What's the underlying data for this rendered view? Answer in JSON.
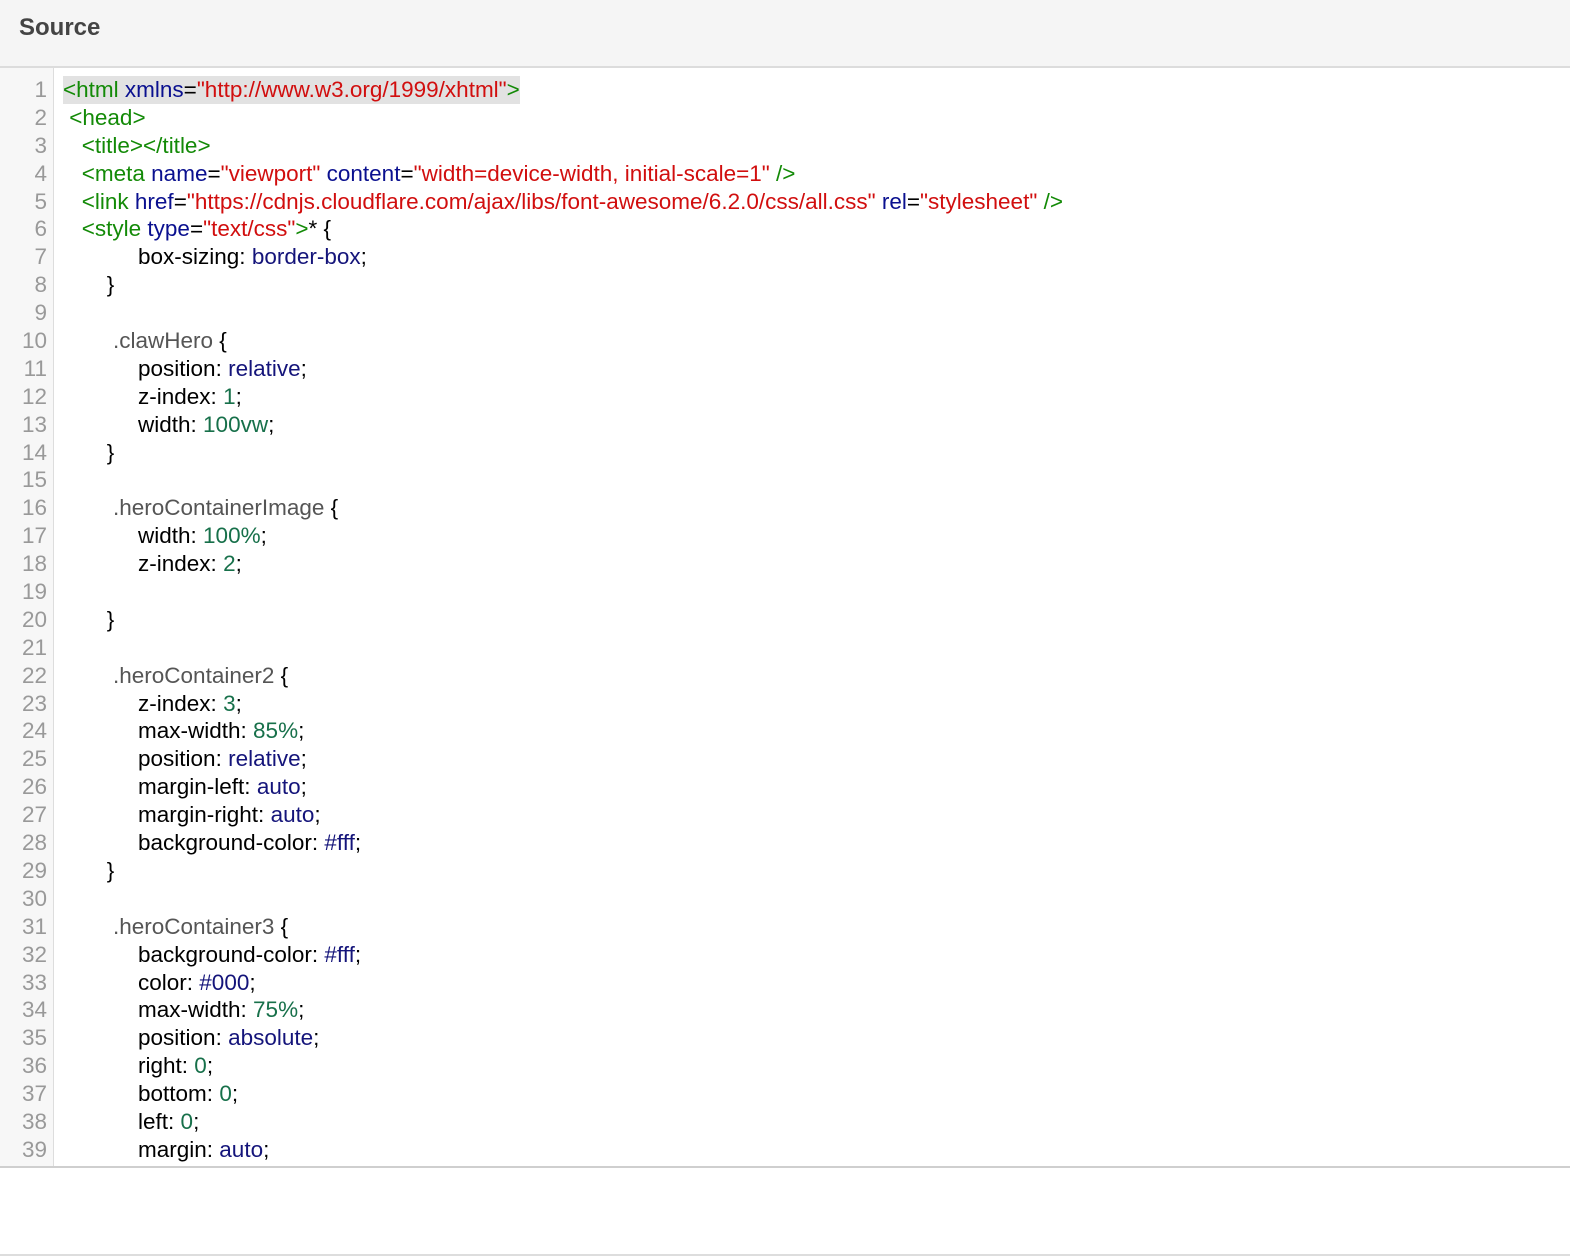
{
  "panel": {
    "title": "Source",
    "highlighted_line": 1
  },
  "colors": {
    "tag": "#138a07",
    "attribute": "#0a108f",
    "string": "#d10e0e",
    "number": "#17704a",
    "keyword": "#14147a",
    "selector": "#555555",
    "plain": "#000000"
  },
  "lines": [
    {
      "n": "1",
      "tokens": [
        [
          "tag",
          "<html "
        ],
        [
          "attr",
          "xmlns"
        ],
        [
          "plain",
          "="
        ],
        [
          "str",
          "\"http://www.w3.org/1999/xhtml\""
        ],
        [
          "tag",
          ">"
        ]
      ]
    },
    {
      "n": "2",
      "tokens": [
        [
          "tag",
          " <head>"
        ]
      ]
    },
    {
      "n": "3",
      "tokens": [
        [
          "tag",
          "   <title></title>"
        ]
      ]
    },
    {
      "n": "4",
      "tokens": [
        [
          "tag",
          "   <meta "
        ],
        [
          "attr",
          "name"
        ],
        [
          "plain",
          "="
        ],
        [
          "str",
          "\"viewport\""
        ],
        [
          "plain",
          " "
        ],
        [
          "attr",
          "content"
        ],
        [
          "plain",
          "="
        ],
        [
          "str",
          "\"width=device-width, initial-scale=1\""
        ],
        [
          "tag",
          " />"
        ]
      ]
    },
    {
      "n": "5",
      "tokens": [
        [
          "tag",
          "   <link "
        ],
        [
          "attr",
          "href"
        ],
        [
          "plain",
          "="
        ],
        [
          "str",
          "\"https://cdnjs.cloudflare.com/ajax/libs/font-awesome/6.2.0/css/all.css\""
        ],
        [
          "plain",
          " "
        ],
        [
          "attr",
          "rel"
        ],
        [
          "plain",
          "="
        ],
        [
          "str",
          "\"stylesheet\""
        ],
        [
          "tag",
          " />"
        ]
      ]
    },
    {
      "n": "6",
      "tokens": [
        [
          "tag",
          "   <style "
        ],
        [
          "attr",
          "type"
        ],
        [
          "plain",
          "="
        ],
        [
          "str",
          "\"text/css\""
        ],
        [
          "tag",
          ">"
        ],
        [
          "plain",
          "* {"
        ]
      ]
    },
    {
      "n": "7",
      "tokens": [
        [
          "plain",
          "            box-sizing: "
        ],
        [
          "kw",
          "border-box"
        ],
        [
          "plain",
          ";"
        ]
      ]
    },
    {
      "n": "8",
      "tokens": [
        [
          "plain",
          "       }"
        ]
      ]
    },
    {
      "n": "9",
      "tokens": [
        [
          "plain",
          ""
        ]
      ]
    },
    {
      "n": "10",
      "tokens": [
        [
          "sel",
          "        .clawHero"
        ],
        [
          "plain",
          " {"
        ]
      ]
    },
    {
      "n": "11",
      "tokens": [
        [
          "plain",
          "            position: "
        ],
        [
          "kw",
          "relative"
        ],
        [
          "plain",
          ";"
        ]
      ]
    },
    {
      "n": "12",
      "tokens": [
        [
          "plain",
          "            z-index: "
        ],
        [
          "num",
          "1"
        ],
        [
          "plain",
          ";"
        ]
      ]
    },
    {
      "n": "13",
      "tokens": [
        [
          "plain",
          "            width: "
        ],
        [
          "num",
          "100vw"
        ],
        [
          "plain",
          ";"
        ]
      ]
    },
    {
      "n": "14",
      "tokens": [
        [
          "plain",
          "       }"
        ]
      ]
    },
    {
      "n": "15",
      "tokens": [
        [
          "plain",
          ""
        ]
      ]
    },
    {
      "n": "16",
      "tokens": [
        [
          "sel",
          "        .heroContainerImage"
        ],
        [
          "plain",
          " {"
        ]
      ]
    },
    {
      "n": "17",
      "tokens": [
        [
          "plain",
          "            width: "
        ],
        [
          "num",
          "100%"
        ],
        [
          "plain",
          ";"
        ]
      ]
    },
    {
      "n": "18",
      "tokens": [
        [
          "plain",
          "            z-index: "
        ],
        [
          "num",
          "2"
        ],
        [
          "plain",
          ";"
        ]
      ]
    },
    {
      "n": "19",
      "tokens": [
        [
          "plain",
          ""
        ]
      ]
    },
    {
      "n": "20",
      "tokens": [
        [
          "plain",
          "       }"
        ]
      ]
    },
    {
      "n": "21",
      "tokens": [
        [
          "plain",
          ""
        ]
      ]
    },
    {
      "n": "22",
      "tokens": [
        [
          "sel",
          "        .heroContainer2"
        ],
        [
          "plain",
          " {"
        ]
      ]
    },
    {
      "n": "23",
      "tokens": [
        [
          "plain",
          "            z-index: "
        ],
        [
          "num",
          "3"
        ],
        [
          "plain",
          ";"
        ]
      ]
    },
    {
      "n": "24",
      "tokens": [
        [
          "plain",
          "            max-width: "
        ],
        [
          "num",
          "85%"
        ],
        [
          "plain",
          ";"
        ]
      ]
    },
    {
      "n": "25",
      "tokens": [
        [
          "plain",
          "            position: "
        ],
        [
          "kw",
          "relative"
        ],
        [
          "plain",
          ";"
        ]
      ]
    },
    {
      "n": "26",
      "tokens": [
        [
          "plain",
          "            margin-left: "
        ],
        [
          "kw",
          "auto"
        ],
        [
          "plain",
          ";"
        ]
      ]
    },
    {
      "n": "27",
      "tokens": [
        [
          "plain",
          "            margin-right: "
        ],
        [
          "kw",
          "auto"
        ],
        [
          "plain",
          ";"
        ]
      ]
    },
    {
      "n": "28",
      "tokens": [
        [
          "plain",
          "            background-color: "
        ],
        [
          "kw",
          "#fff"
        ],
        [
          "plain",
          ";"
        ]
      ]
    },
    {
      "n": "29",
      "tokens": [
        [
          "plain",
          "       }"
        ]
      ]
    },
    {
      "n": "30",
      "tokens": [
        [
          "plain",
          ""
        ]
      ]
    },
    {
      "n": "31",
      "tokens": [
        [
          "sel",
          "        .heroContainer3"
        ],
        [
          "plain",
          " {"
        ]
      ]
    },
    {
      "n": "32",
      "tokens": [
        [
          "plain",
          "            background-color: "
        ],
        [
          "kw",
          "#fff"
        ],
        [
          "plain",
          ";"
        ]
      ]
    },
    {
      "n": "33",
      "tokens": [
        [
          "plain",
          "            color: "
        ],
        [
          "kw",
          "#000"
        ],
        [
          "plain",
          ";"
        ]
      ]
    },
    {
      "n": "34",
      "tokens": [
        [
          "plain",
          "            max-width: "
        ],
        [
          "num",
          "75%"
        ],
        [
          "plain",
          ";"
        ]
      ]
    },
    {
      "n": "35",
      "tokens": [
        [
          "plain",
          "            position: "
        ],
        [
          "kw",
          "absolute"
        ],
        [
          "plain",
          ";"
        ]
      ]
    },
    {
      "n": "36",
      "tokens": [
        [
          "plain",
          "            right: "
        ],
        [
          "num",
          "0"
        ],
        [
          "plain",
          ";"
        ]
      ]
    },
    {
      "n": "37",
      "tokens": [
        [
          "plain",
          "            bottom: "
        ],
        [
          "num",
          "0"
        ],
        [
          "plain",
          ";"
        ]
      ]
    },
    {
      "n": "38",
      "tokens": [
        [
          "plain",
          "            left: "
        ],
        [
          "num",
          "0"
        ],
        [
          "plain",
          ";"
        ]
      ]
    },
    {
      "n": "39",
      "tokens": [
        [
          "plain",
          "            margin: "
        ],
        [
          "kw",
          "auto"
        ],
        [
          "plain",
          ";"
        ]
      ]
    }
  ]
}
